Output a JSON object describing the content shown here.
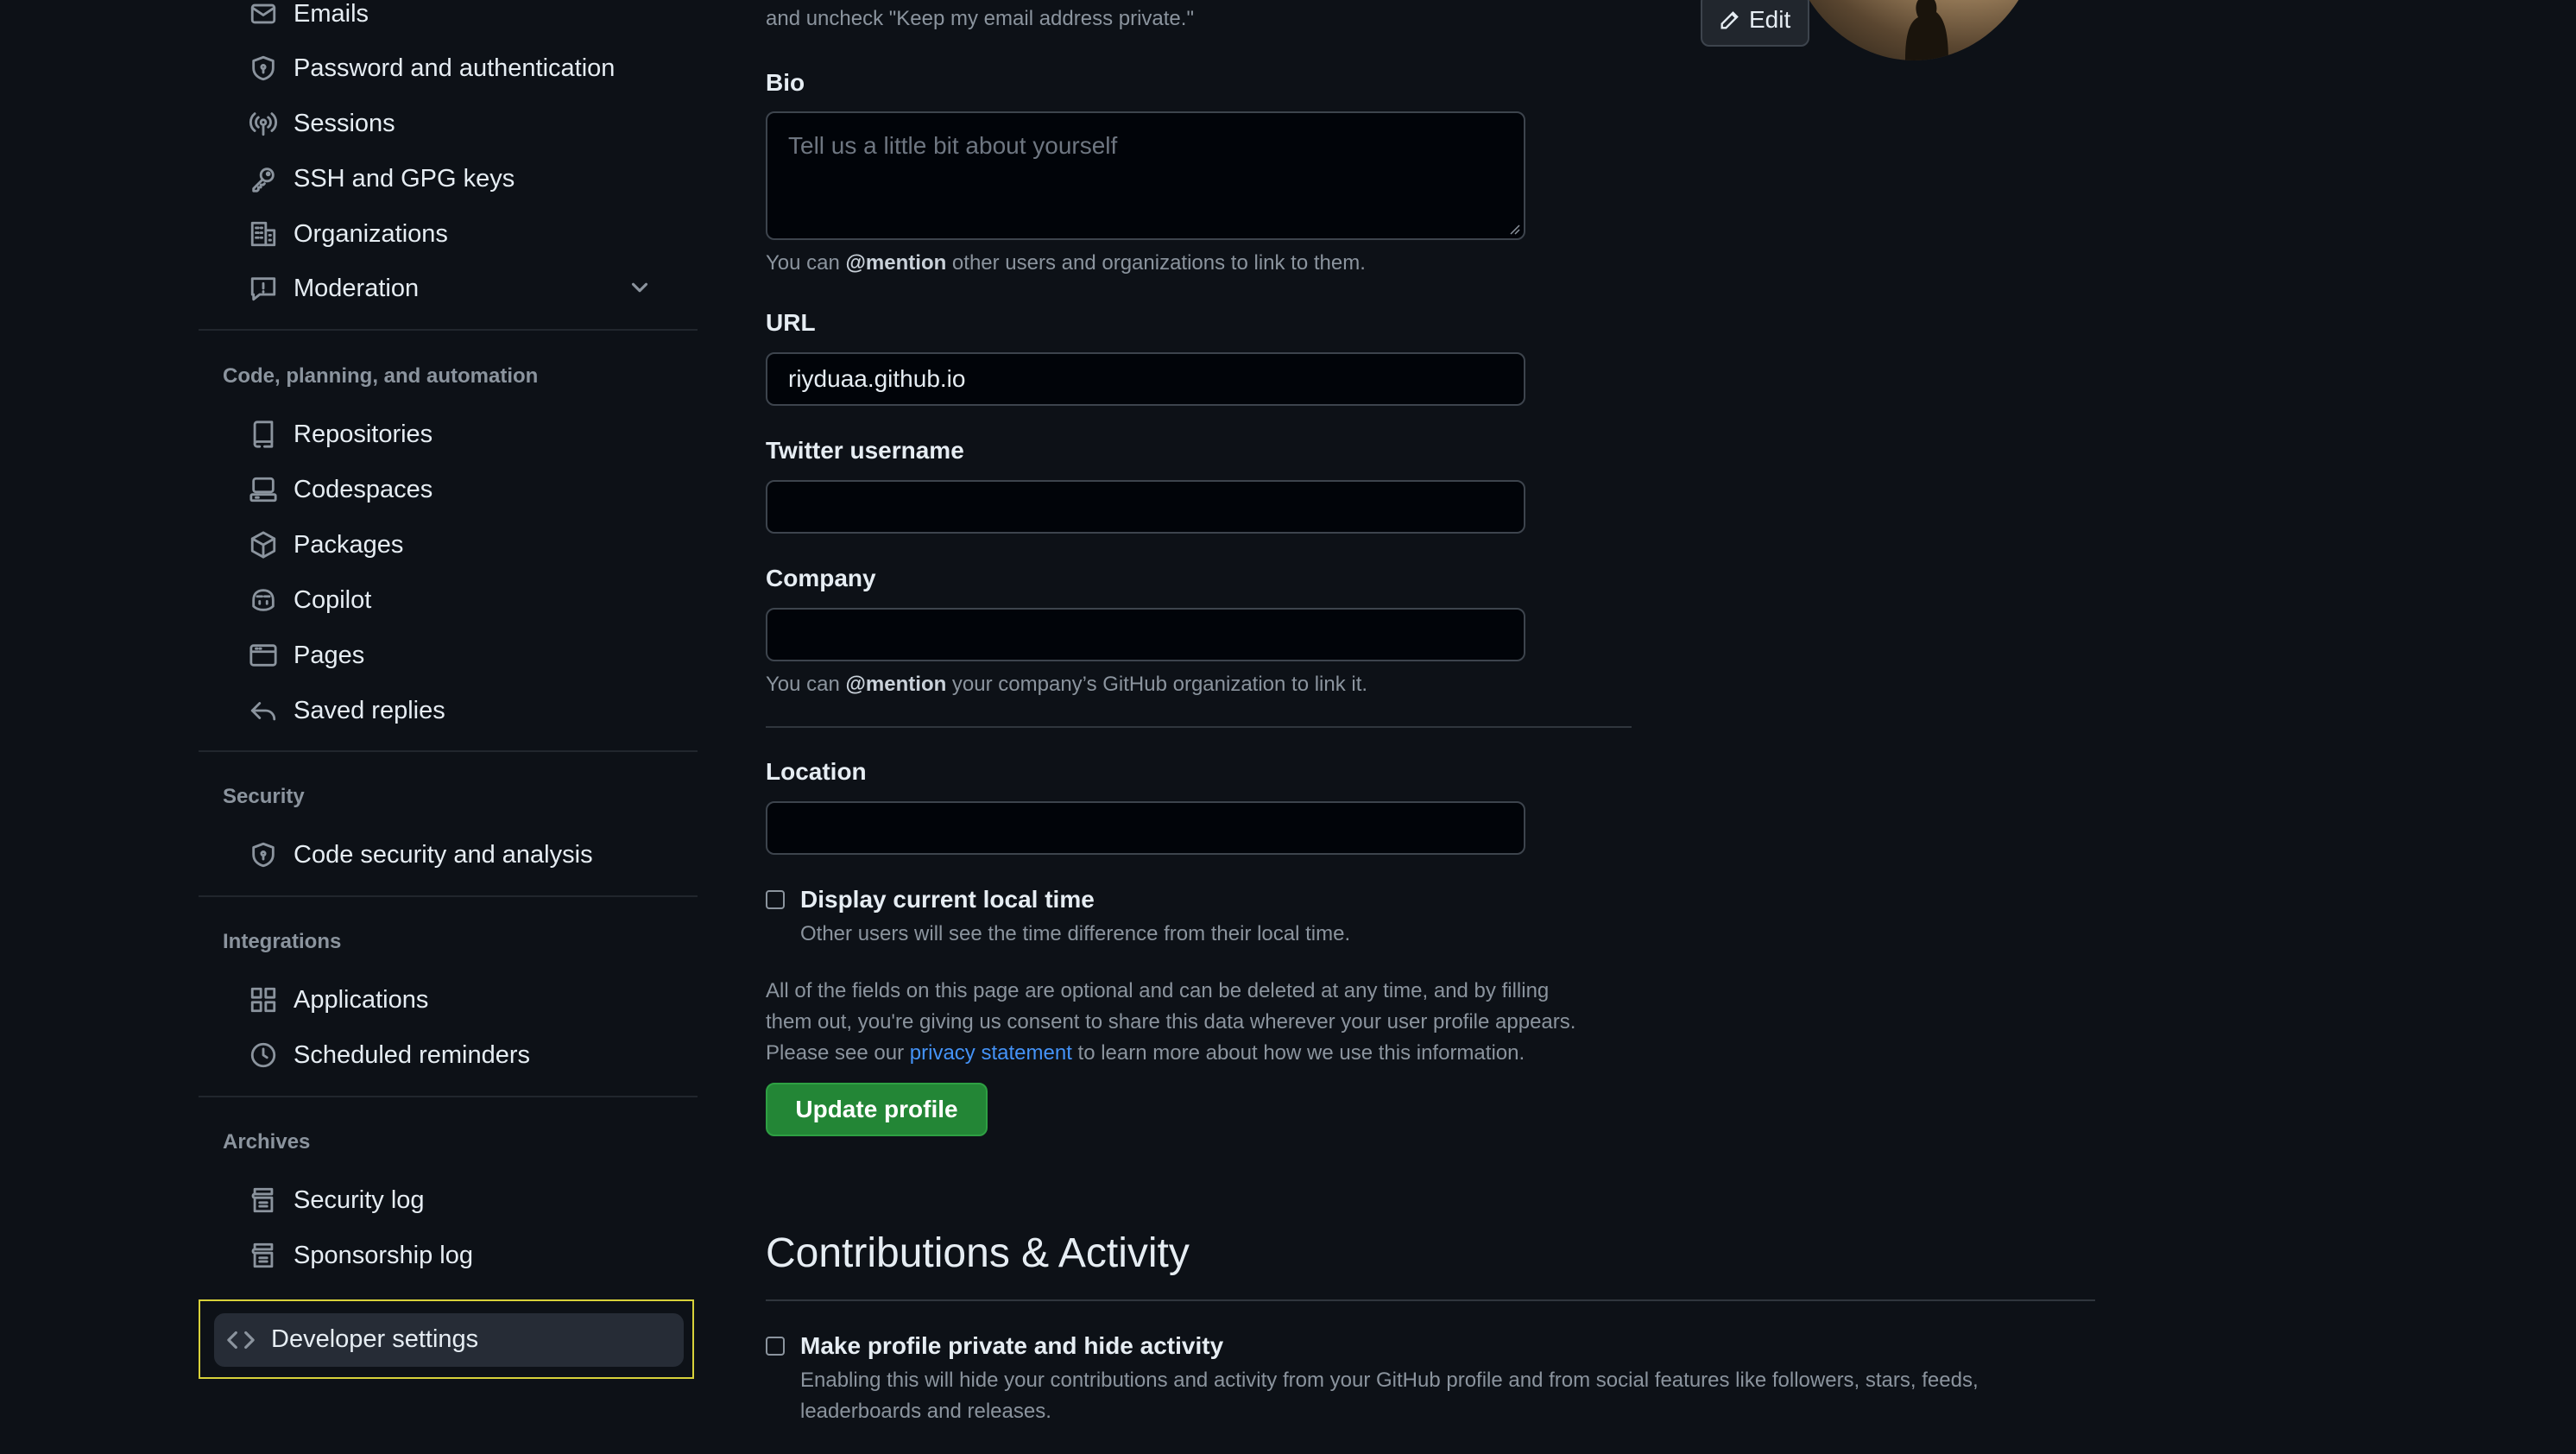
{
  "sidebar": {
    "items_top": [
      {
        "label": "Emails",
        "icon": "mail-icon"
      },
      {
        "label": "Password and authentication",
        "icon": "shield-lock-icon"
      },
      {
        "label": "Sessions",
        "icon": "broadcast-icon"
      },
      {
        "label": "SSH and GPG keys",
        "icon": "key-icon"
      },
      {
        "label": "Organizations",
        "icon": "organization-icon"
      },
      {
        "label": "Moderation",
        "icon": "report-icon"
      }
    ],
    "section_code": "Code, planning, and automation",
    "items_code": [
      {
        "label": "Repositories",
        "icon": "repo-icon"
      },
      {
        "label": "Codespaces",
        "icon": "codespaces-icon"
      },
      {
        "label": "Packages",
        "icon": "package-icon"
      },
      {
        "label": "Copilot",
        "icon": "copilot-icon"
      },
      {
        "label": "Pages",
        "icon": "browser-icon"
      },
      {
        "label": "Saved replies",
        "icon": "reply-icon"
      }
    ],
    "section_security": "Security",
    "items_security": [
      {
        "label": "Code security and analysis",
        "icon": "shield-lock-icon"
      }
    ],
    "section_integrations": "Integrations",
    "items_integrations": [
      {
        "label": "Applications",
        "icon": "apps-icon"
      },
      {
        "label": "Scheduled reminders",
        "icon": "clock-icon"
      }
    ],
    "section_archives": "Archives",
    "items_archives": [
      {
        "label": "Security log",
        "icon": "log-icon"
      },
      {
        "label": "Sponsorship log",
        "icon": "log-icon"
      }
    ],
    "developer_settings": "Developer settings"
  },
  "main": {
    "email_help_tail": "and uncheck \"Keep my email address private.\"",
    "bio": {
      "label": "Bio",
      "placeholder": "Tell us a little bit about yourself",
      "help_prefix": "You can ",
      "help_mention": "@mention",
      "help_suffix": " other users and organizations to link to them."
    },
    "url": {
      "label": "URL",
      "value": "riyduaa.github.io"
    },
    "twitter": {
      "label": "Twitter username",
      "value": ""
    },
    "company": {
      "label": "Company",
      "value": "",
      "help_prefix": "You can ",
      "help_mention": "@mention",
      "help_suffix": " your company’s GitHub organization to link it."
    },
    "location": {
      "label": "Location",
      "value": ""
    },
    "local_time": {
      "label": "Display current local time",
      "help": "Other users will see the time difference from their local time."
    },
    "consent": {
      "line1": "All of the fields on this page are optional and can be deleted at any time, and by filling",
      "line2": "them out, you're giving us consent to share this data wherever your user profile appears.",
      "line3_prefix": "Please see our ",
      "line3_link": "privacy statement",
      "line3_suffix": " to learn more about how we use this information."
    },
    "update_button": "Update profile",
    "contributions": {
      "title": "Contributions & Activity",
      "private_label": "Make profile private and hide activity",
      "private_help1": "Enabling this will hide your contributions and activity from your GitHub profile and from social features like followers, stars, feeds,",
      "private_help2": "leaderboards and releases."
    },
    "edit_button": "Edit"
  },
  "colors": {
    "background": "#0d1117",
    "accent_green": "#238636",
    "link_blue": "#4493f8",
    "highlight_yellow": "#d8d13a"
  }
}
